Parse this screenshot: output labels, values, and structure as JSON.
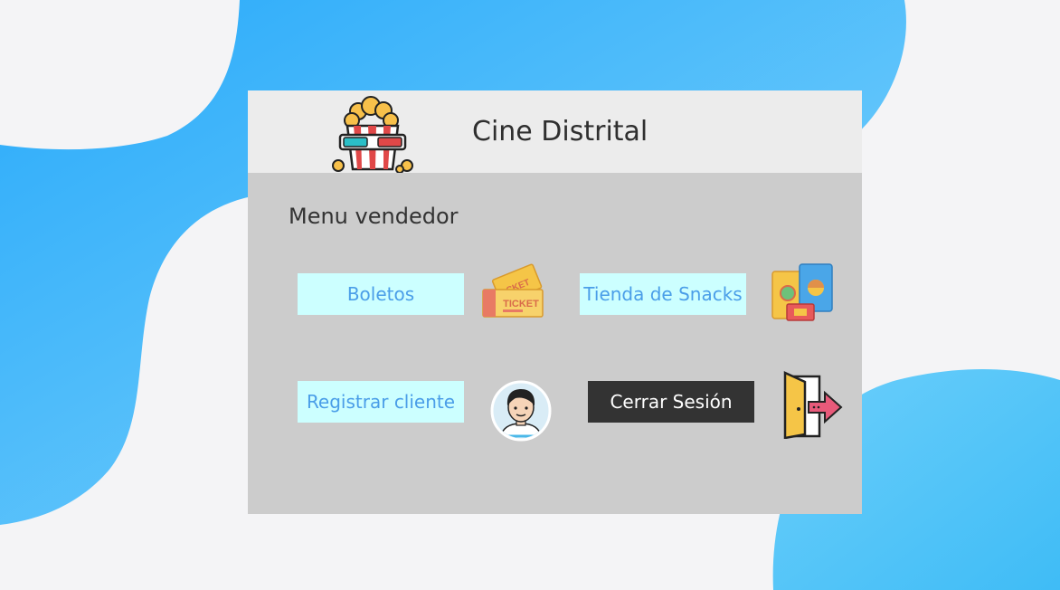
{
  "header": {
    "title": "Cine Distrital",
    "logo_icon": "popcorn-3d-glasses-icon"
  },
  "main": {
    "subtitle": "Menu vendedor",
    "buttons": [
      {
        "label": "Boletos",
        "icon": "ticket-icon",
        "style": "light"
      },
      {
        "label": "Tienda de Snacks",
        "icon": "snacks-icon",
        "style": "light"
      },
      {
        "label": "Registrar cliente",
        "icon": "user-avatar-icon",
        "style": "light"
      },
      {
        "label": "Cerrar Sesión",
        "icon": "exit-door-icon",
        "style": "dark"
      }
    ]
  },
  "colors": {
    "background": "#f4f4f6",
    "blob_blue": "#4db8fb",
    "panel": "#cccccc",
    "header": "#ececec",
    "button_light": "#ccffff",
    "button_light_text": "#4a9ee8",
    "button_dark": "#333333",
    "button_dark_text": "#ffffff"
  }
}
